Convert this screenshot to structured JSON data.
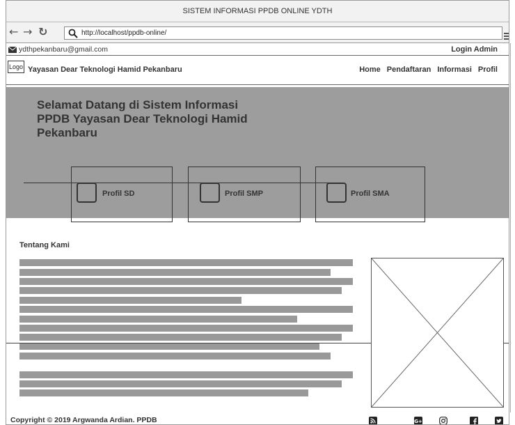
{
  "window": {
    "title": "SISTEM INFORMASI PPDB ONLINE YDTH"
  },
  "browser": {
    "url": "http://localhost/ppdb-online/"
  },
  "topbar": {
    "email": "ydthpekanbaru@gmail.com",
    "login_label": "Login Admin"
  },
  "navbar": {
    "logo_text": "Logo",
    "brand": "Yayasan Dear Teknologi Hamid Pekanbaru",
    "links": [
      "Home",
      "Pendaftaran",
      "Informasi",
      "Profil"
    ]
  },
  "hero": {
    "title": "Selamat Datang di Sistem Informasi PPDB Yayasan Dear Teknologi Hamid Pekanbaru",
    "cards": [
      "Profil SD",
      "Profil SMP",
      "Profil SMA"
    ]
  },
  "about": {
    "title": "Tentang Kami"
  },
  "footer": {
    "copyright": "Copyright © 2019 Argwanda Ardian. PPDB",
    "social_icons": [
      "rss-icon",
      "google-plus-icon",
      "instagram-icon",
      "facebook-icon",
      "twitter-icon"
    ]
  }
}
